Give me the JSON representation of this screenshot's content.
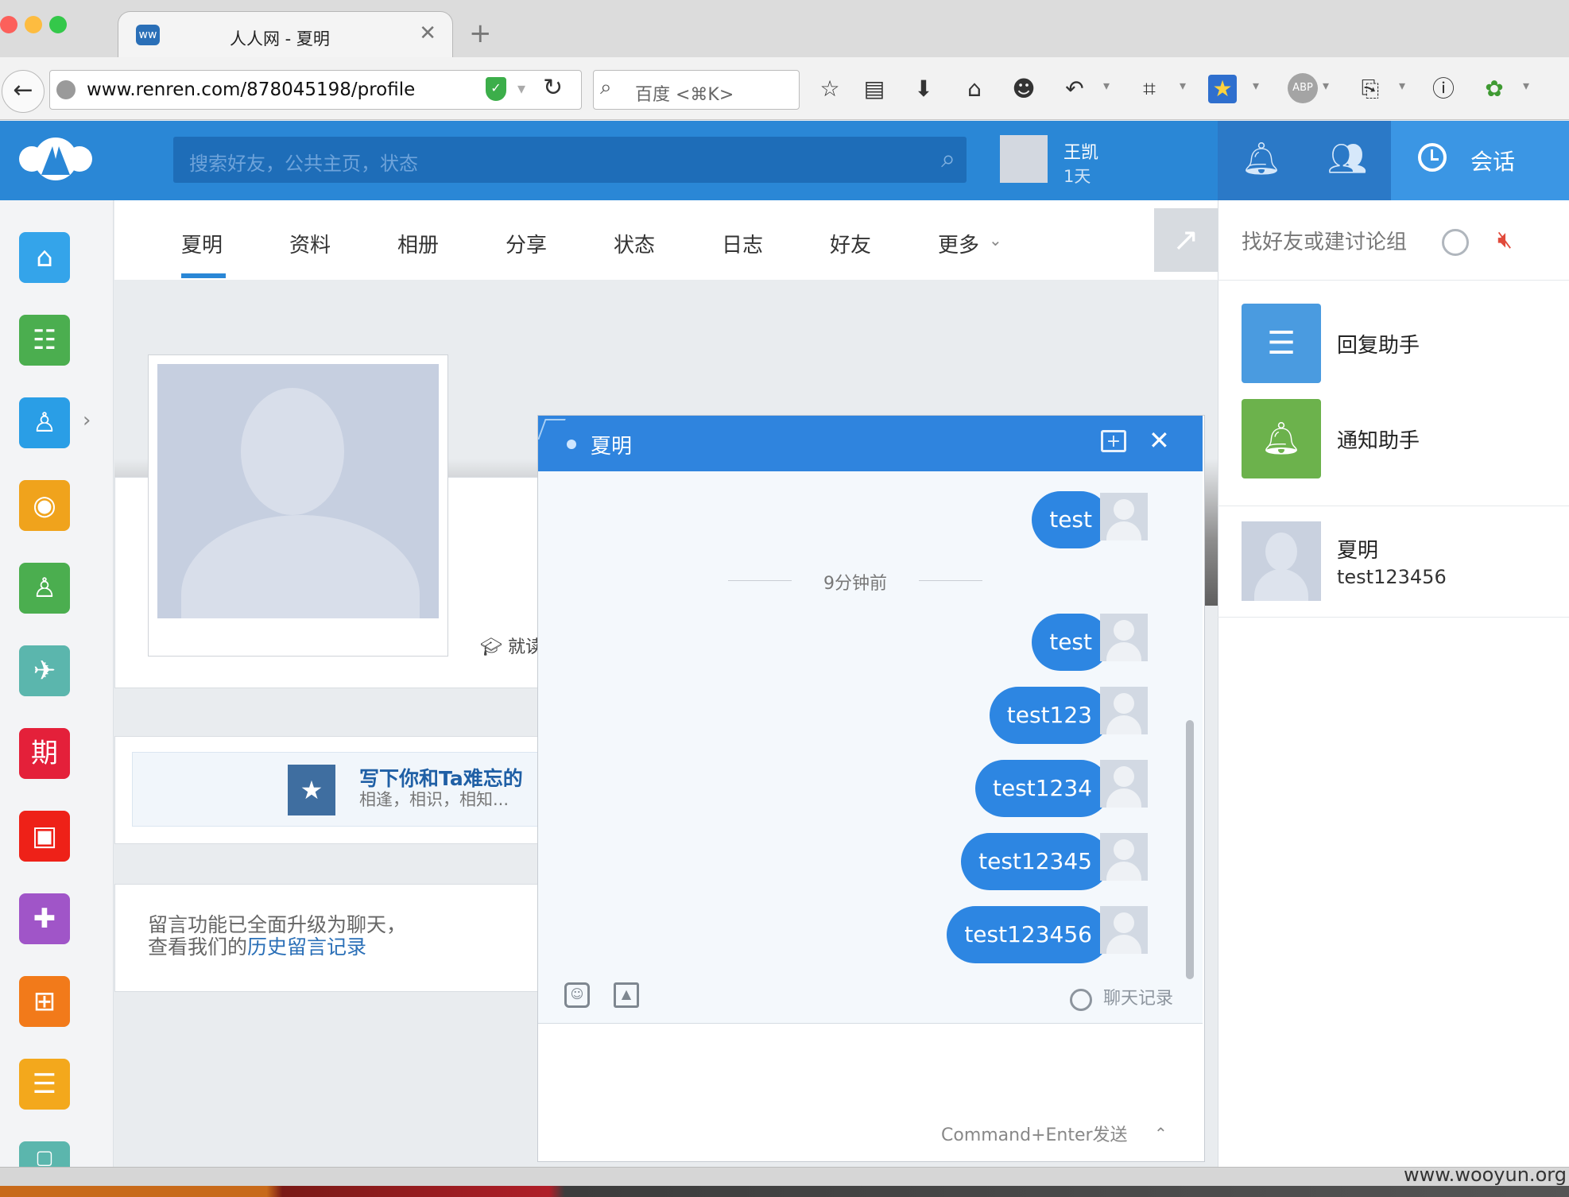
{
  "browser": {
    "tab_title": "人人网 - 夏明",
    "tab_close": "✕",
    "new_tab": "+",
    "url": "www.renren.com/878045198/profile",
    "search_placeholder": "百度 <⌘K>",
    "toolbar_icons": [
      "bookmark-star-icon",
      "reading-list-icon",
      "download-icon",
      "home-icon",
      "chat-icon",
      "undo-icon",
      "crop-icon",
      "favorites-icon",
      "adblock-icon",
      "clipboard-icon",
      "info-icon",
      "extension-icon"
    ],
    "adblock_label": "ABP"
  },
  "site": {
    "search_placeholder": "搜索好友，公共主页，状态",
    "user_name": "王凯",
    "user_age": "1天",
    "session_tab": "会话",
    "brand_color": "#2a87d6"
  },
  "left_apps": [
    "home-icon",
    "profile-card-icon",
    "person-icon",
    "photo-icon",
    "friends-icon",
    "share-icon",
    "calendar-icon",
    "live-icon",
    "game-icon",
    "apps-icon",
    "bookmark-icon",
    "more-icon"
  ],
  "left_apps_text": {
    "calendar": "期"
  },
  "profile_nav": {
    "items": [
      "夏明",
      "资料",
      "相册",
      "分享",
      "状态",
      "日志",
      "好友",
      "更多"
    ],
    "active": "夏明"
  },
  "profile": {
    "name_partial": "夏明",
    "school_partial": "就读",
    "memory_title": "写下你和Ta难忘的",
    "memory_sub": "相逢，相识，相知...",
    "msg_line1": "留言功能已全面升级为聊天，",
    "msg_line2_prefix": "查看我们的",
    "msg_link": "历史留言记录"
  },
  "chat": {
    "title": "夏明",
    "time_separator": "9分钟前",
    "messages": [
      "test",
      "test",
      "test123",
      "test1234",
      "test12345",
      "test123456"
    ],
    "history_label": "聊天记录",
    "send_hint": "Command+Enter发送",
    "send_caret": "⌃"
  },
  "right_panel": {
    "search_placeholder": "找好友或建讨论组",
    "items": [
      {
        "label": "回复助手",
        "color": "#4a9be0"
      },
      {
        "label": "通知助手",
        "color": "#6cb24c"
      }
    ],
    "contact": {
      "name": "夏明",
      "last_message": "test123456"
    }
  },
  "watermark": "www.wooyun.org"
}
